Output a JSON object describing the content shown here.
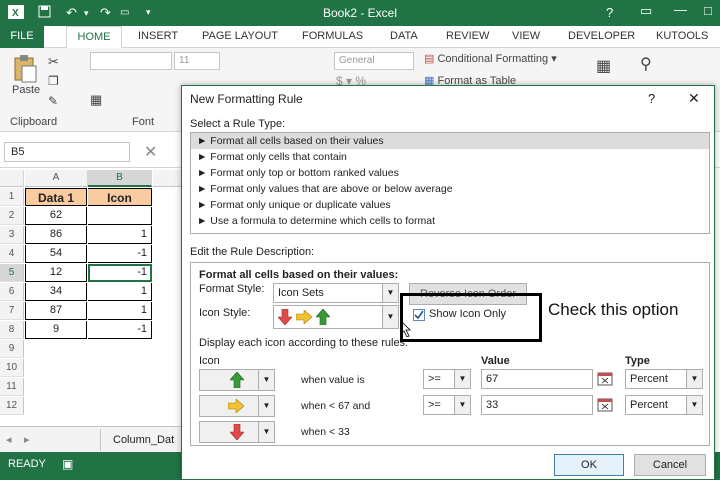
{
  "window": {
    "title": "Book2 - Excel",
    "help": "?",
    "minimize": "—",
    "restore": "□"
  },
  "ribbon_tabs": [
    "FILE",
    "HOME",
    "INSERT",
    "PAGE LAYOUT",
    "FORMULAS",
    "DATA",
    "REVIEW",
    "VIEW",
    "DEVELOPER",
    "KUTOOLS"
  ],
  "ribbon": {
    "paste": "Paste",
    "clipboard": "Clipboard",
    "font_group": "Font",
    "font_size": "11",
    "number_format": "General",
    "conditional_formatting": "Conditional Formatting",
    "format_as_table": "Format as Table"
  },
  "formula_bar": {
    "name_box": "B5",
    "cancel": "✕"
  },
  "sheet": {
    "columns": [
      "A",
      "B"
    ],
    "rows": [
      "1",
      "2",
      "3",
      "4",
      "5",
      "6",
      "7",
      "8",
      "9",
      "10",
      "11",
      "12"
    ],
    "header": {
      "a": "Data 1",
      "b": "Icon"
    },
    "data_a": [
      "62",
      "86",
      "54",
      "12",
      "34",
      "87",
      "9"
    ],
    "data_b": [
      "",
      "1",
      "-1",
      "-1",
      "1",
      "1",
      "-1"
    ],
    "sheet_tab": "Column_Dat"
  },
  "status": {
    "ready": "READY"
  },
  "dialog": {
    "title": "New Formatting Rule",
    "help": "?",
    "close": "✕",
    "select_rule_type": "Select a Rule Type:",
    "rule_types": [
      "► Format all cells based on their values",
      "► Format only cells that contain",
      "► Format only top or bottom ranked values",
      "► Format only values that are above or below average",
      "► Format only unique or duplicate values",
      "► Use a formula to determine which cells to format"
    ],
    "edit_rule": "Edit the Rule Description:",
    "format_all": "Format all cells based on their values:",
    "format_style_label": "Format Style:",
    "format_style_value": "Icon Sets",
    "reverse_icon_order": "Reverse Icon Order",
    "icon_style_label": "Icon Style:",
    "show_icon_only": "Show Icon Only",
    "display_each": "Display each icon according to these rules:",
    "col_icon": "Icon",
    "col_value": "Value",
    "col_type": "Type",
    "rules": [
      {
        "cond": "when value is",
        "op": ">=",
        "value": "67",
        "type": "Percent"
      },
      {
        "cond": "when < 67 and",
        "op": ">=",
        "value": "33",
        "type": "Percent"
      },
      {
        "cond": "when < 33",
        "op": "",
        "value": "",
        "type": ""
      }
    ],
    "ok": "OK",
    "cancel": "Cancel"
  },
  "callout": {
    "text": "Check this option"
  },
  "colors": {
    "excel_green": "#217346",
    "header_fill": "#f8cba0",
    "arrow_green": "#3a9a3a",
    "arrow_yellow": "#f2c230",
    "arrow_red": "#e04a4a"
  }
}
